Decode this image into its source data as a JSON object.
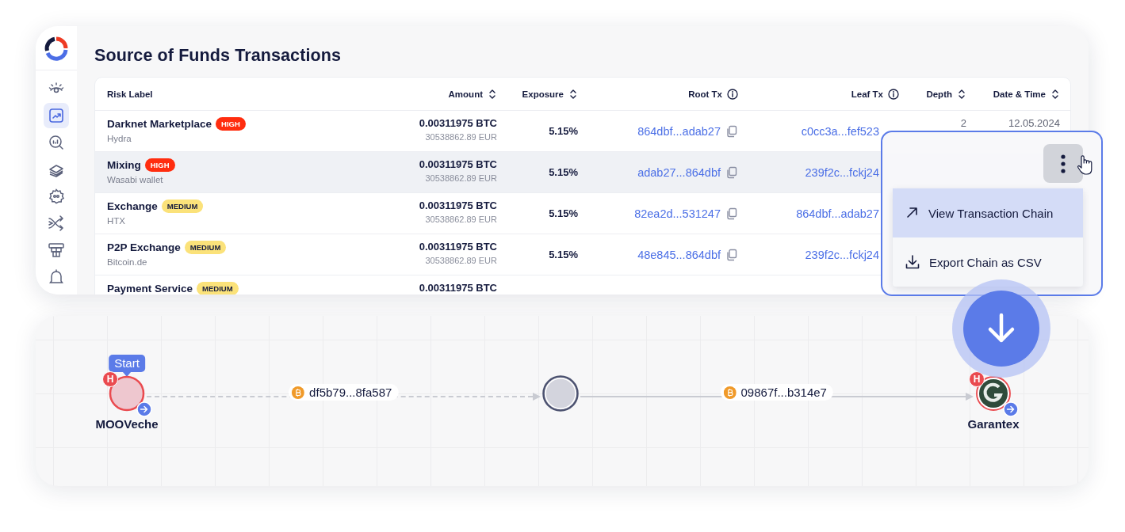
{
  "sidebar": {
    "items": [
      {
        "selected": false
      },
      {
        "selected": true
      },
      {
        "selected": false
      },
      {
        "selected": false
      },
      {
        "selected": false
      },
      {
        "selected": false
      },
      {
        "selected": false
      },
      {
        "selected": false
      }
    ]
  },
  "title": "Source of Funds Transactions",
  "table": {
    "columns": [
      {
        "label": "Risk Label",
        "kind": "plain"
      },
      {
        "label": "Amount",
        "kind": "sort"
      },
      {
        "label": "Exposure",
        "kind": "sort"
      },
      {
        "label": "Root Tx",
        "kind": "info"
      },
      {
        "label": "Leaf Tx",
        "kind": "info"
      },
      {
        "label": "Depth",
        "kind": "sort"
      },
      {
        "label": "Date & Time",
        "kind": "sort"
      }
    ],
    "rows": [
      {
        "name": "Darknet Marketplace",
        "badge": {
          "text": "HIGH",
          "color": "#ff2d0f"
        },
        "entity": "Hydra",
        "amount": "0.00311975 BTC",
        "fiat": "30538862.89 EUR",
        "exposure": "5.15%",
        "root_tx": "864dbf...adab27",
        "leaf_tx": "c0cc3a...fef523",
        "depth": "2",
        "date": "12.05.2024",
        "selected": false
      },
      {
        "name": "Mixing",
        "badge": {
          "text": "HIGH",
          "color": "#ff2d0f"
        },
        "entity": "Wasabi wallet",
        "amount": "0.00311975 BTC",
        "fiat": "30538862.89 EUR",
        "exposure": "5.15%",
        "root_tx": "adab27...864dbf",
        "leaf_tx": "239f2c...fckj24",
        "selected": true
      },
      {
        "name": "Exchange",
        "badge": {
          "text": "MEDIUM",
          "color": "#fbe27a"
        },
        "entity": "HTX",
        "amount": "0.00311975 BTC",
        "fiat": "30538862.89 EUR",
        "exposure": "5.15%",
        "root_tx": "82ea2d...531247",
        "leaf_tx": "864dbf...adab27",
        "selected": false
      },
      {
        "name": "P2P Exchange",
        "badge": {
          "text": "MEDIUM",
          "color": "#fbe27a"
        },
        "entity": "Bitcoin.de",
        "amount": "0.00311975 BTC",
        "fiat": "30538862.89 EUR",
        "exposure": "5.15%",
        "root_tx": "48e845...864dbf",
        "leaf_tx": "239f2c...fckj24",
        "selected": false
      },
      {
        "name": "Payment Service",
        "badge": {
          "text": "MEDIUM",
          "color": "#fbe27a"
        },
        "amount": "0.00311975 BTC",
        "selected": false
      }
    ]
  },
  "menu": {
    "items": [
      {
        "label": "View Transaction Chain",
        "kind": "open",
        "selected": true
      },
      {
        "label": "Export Chain as CSV",
        "kind": "download",
        "selected": false
      }
    ]
  },
  "graph": {
    "nodes": [
      {
        "kind": "wallet",
        "label": "MOOVeche",
        "tag": "Start",
        "risk": "H"
      },
      {
        "kind": "hop"
      },
      {
        "kind": "exchange",
        "label": "Garantex",
        "risk": "H"
      }
    ],
    "edges": [
      {
        "label": "df5b79...8fa587",
        "kind": "dashed"
      },
      {
        "label": "09867f...b314e7",
        "kind": "solid"
      }
    ]
  }
}
